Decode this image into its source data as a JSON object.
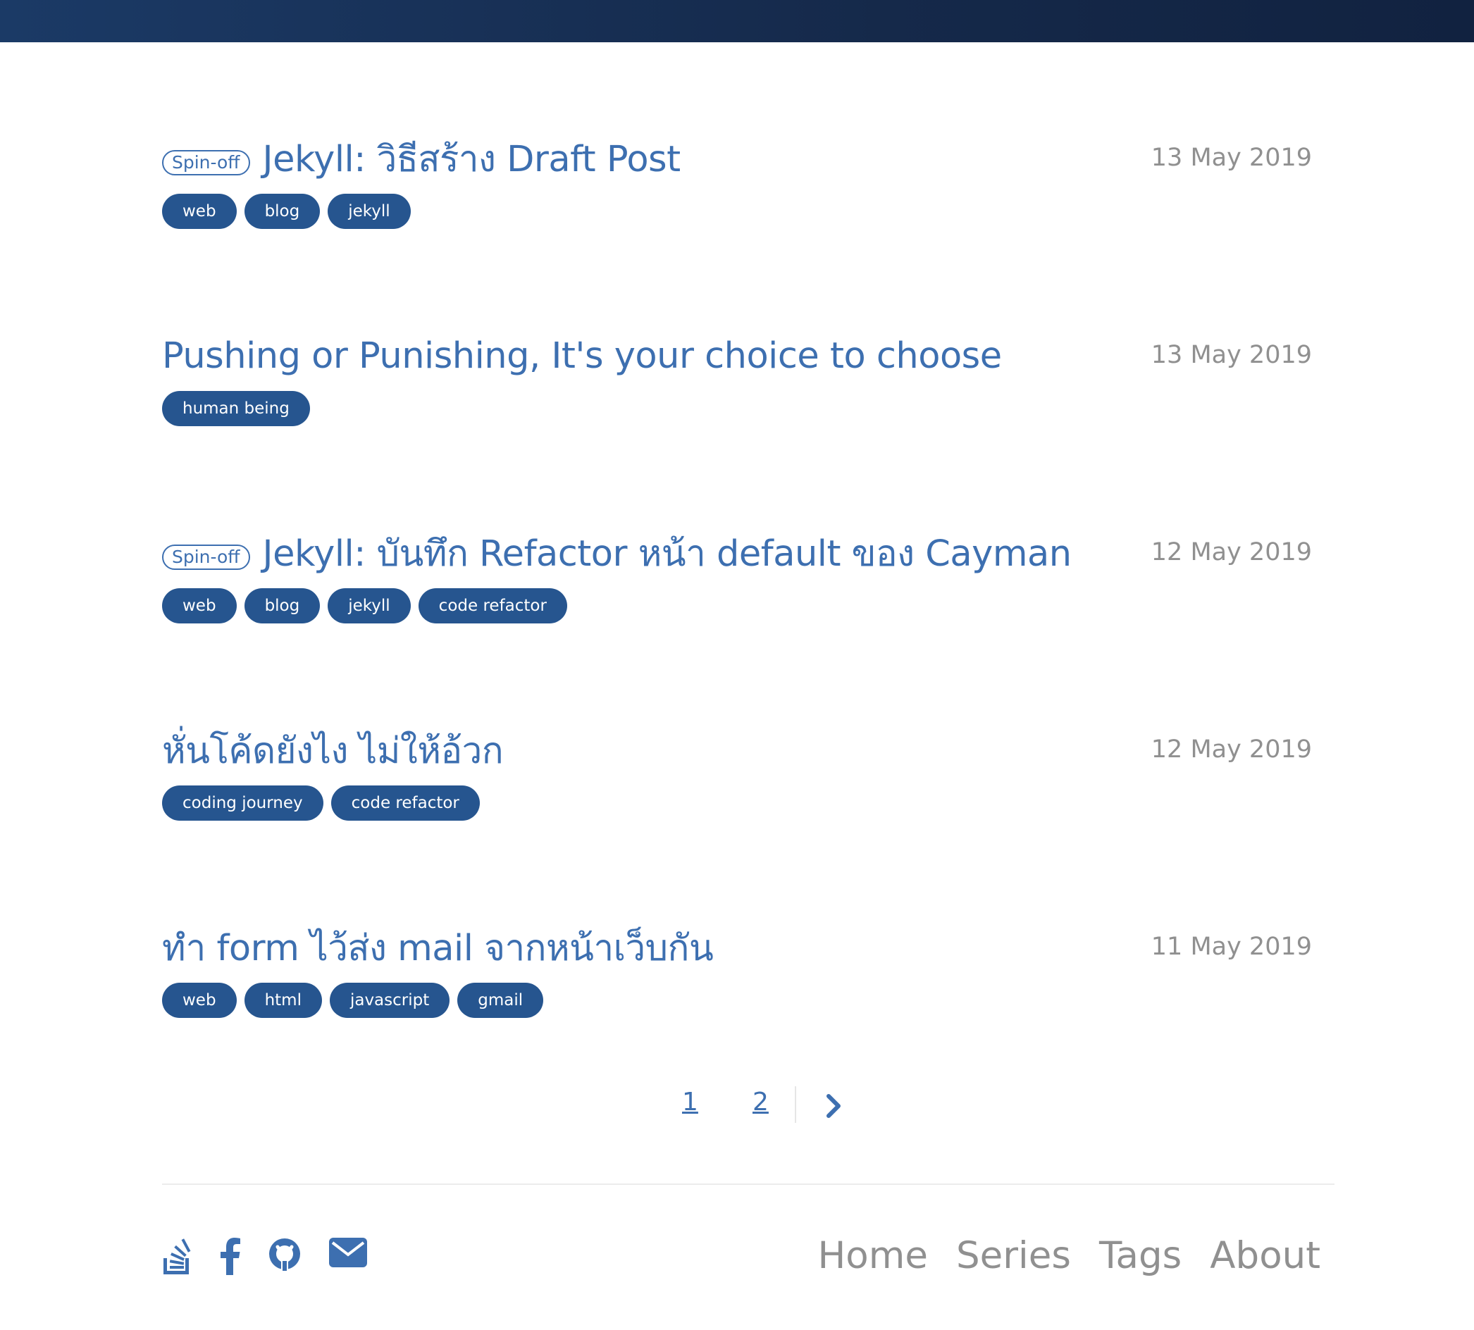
{
  "colors": {
    "header_bar": "#1b3a66",
    "link_blue": "#3d6fb0",
    "tag_bg": "#26558f",
    "date_gray": "#909090"
  },
  "posts": [
    {
      "badge": "Spin-off",
      "title": "Jekyll: วิธีสร้าง Draft Post",
      "date": "13 May 2019",
      "tags": [
        "web",
        "blog",
        "jekyll"
      ]
    },
    {
      "badge": "",
      "title": "Pushing or Punishing, It's your choice to choose",
      "date": "13 May 2019",
      "tags": [
        "human being"
      ]
    },
    {
      "badge": "Spin-off",
      "title": "Jekyll: บันทึก Refactor หน้า default ของ Cayman",
      "date": "12 May 2019",
      "tags": [
        "web",
        "blog",
        "jekyll",
        "code refactor"
      ]
    },
    {
      "badge": "",
      "title": "หั่นโค้ดยังไง ไม่ให้อ้วก",
      "date": "12 May 2019",
      "tags": [
        "coding journey",
        "code refactor"
      ]
    },
    {
      "badge": "",
      "title": "ทำ form ไว้ส่ง mail จากหน้าเว็บกัน",
      "date": "11 May 2019",
      "tags": [
        "web",
        "html",
        "javascript",
        "gmail"
      ]
    }
  ],
  "pagination": {
    "pages": [
      "1",
      "2"
    ],
    "next_icon": "chevron-right-icon"
  },
  "social_icons": [
    "stackoverflow-icon",
    "facebook-icon",
    "github-icon",
    "mail-icon"
  ],
  "footer_nav": [
    "Home",
    "Series",
    "Tags",
    "About"
  ]
}
